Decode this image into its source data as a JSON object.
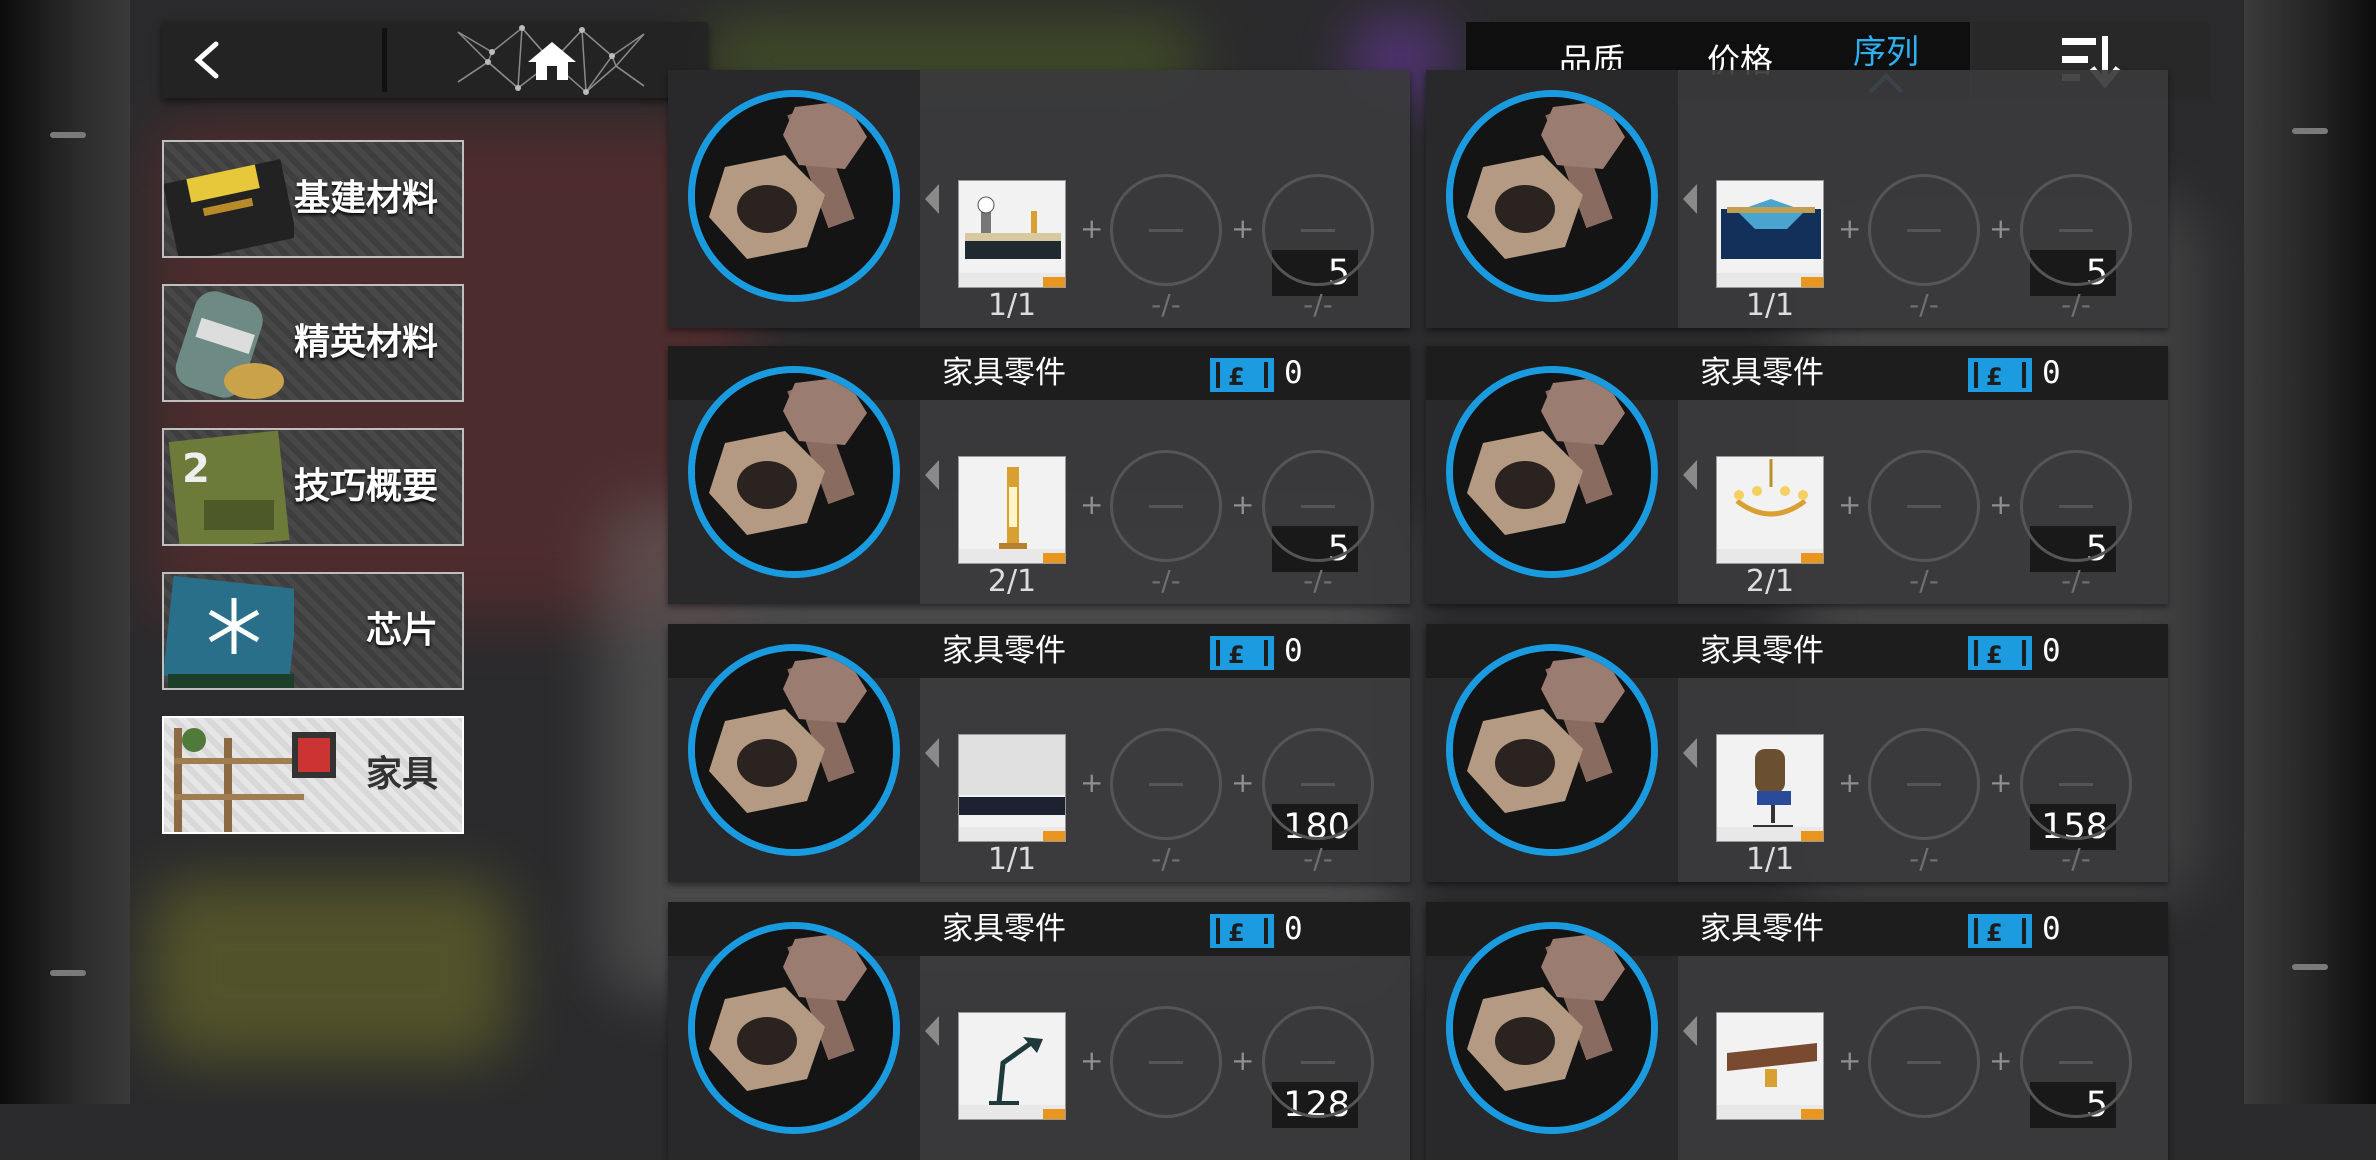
{
  "topbar": {
    "back_icon": "chevron-left-icon",
    "home_icon": "home-icon"
  },
  "sort": {
    "tabs": [
      {
        "label": "品质",
        "active": false
      },
      {
        "label": "价格",
        "active": false
      },
      {
        "label": "序列",
        "active": true
      }
    ],
    "order_icon": "sort-descending-icon",
    "accent": "#2fb0ef"
  },
  "categories": [
    {
      "label": "基建材料",
      "active": false
    },
    {
      "label": "精英材料",
      "active": false
    },
    {
      "label": "技巧概要",
      "active": false
    },
    {
      "label": "芯片",
      "active": false
    },
    {
      "label": "家具",
      "active": true
    }
  ],
  "recipes": [
    {
      "title": "",
      "ticket_count": "",
      "part_count": "5",
      "item": "furniture-counter",
      "item_count": "1/1",
      "slot2": "-/-",
      "slot3": "-/-"
    },
    {
      "title": "",
      "ticket_count": "",
      "part_count": "5",
      "item": "furniture-blue-bed",
      "item_count": "1/1",
      "slot2": "-/-",
      "slot3": "-/-"
    },
    {
      "title": "家具零件",
      "ticket_count": "0",
      "part_count": "5",
      "item": "furniture-pillar-lamp",
      "item_count": "2/1",
      "slot2": "-/-",
      "slot3": "-/-"
    },
    {
      "title": "家具零件",
      "ticket_count": "0",
      "part_count": "5",
      "item": "furniture-chandelier",
      "item_count": "2/1",
      "slot2": "-/-",
      "slot3": "-/-"
    },
    {
      "title": "家具零件",
      "ticket_count": "0",
      "part_count": "180",
      "item": "furniture-wall-panel",
      "item_count": "1/1",
      "slot2": "-/-",
      "slot3": "-/-"
    },
    {
      "title": "家具零件",
      "ticket_count": "0",
      "part_count": "158",
      "item": "furniture-office-chair",
      "item_count": "1/1",
      "slot2": "-/-",
      "slot3": "-/-"
    },
    {
      "title": "家具零件",
      "ticket_count": "0",
      "part_count": "128",
      "item": "furniture-desk-lamp",
      "item_count": "",
      "slot2": "",
      "slot3": ""
    },
    {
      "title": "家具零件",
      "ticket_count": "0",
      "part_count": "5",
      "item": "furniture-wall-shelf",
      "item_count": "",
      "slot2": "",
      "slot3": ""
    }
  ],
  "plus_sign": "+",
  "part_icon": "bolt-nut-icon",
  "ticket_icon": "ticket-icon",
  "ring_color": "#1a9be0"
}
